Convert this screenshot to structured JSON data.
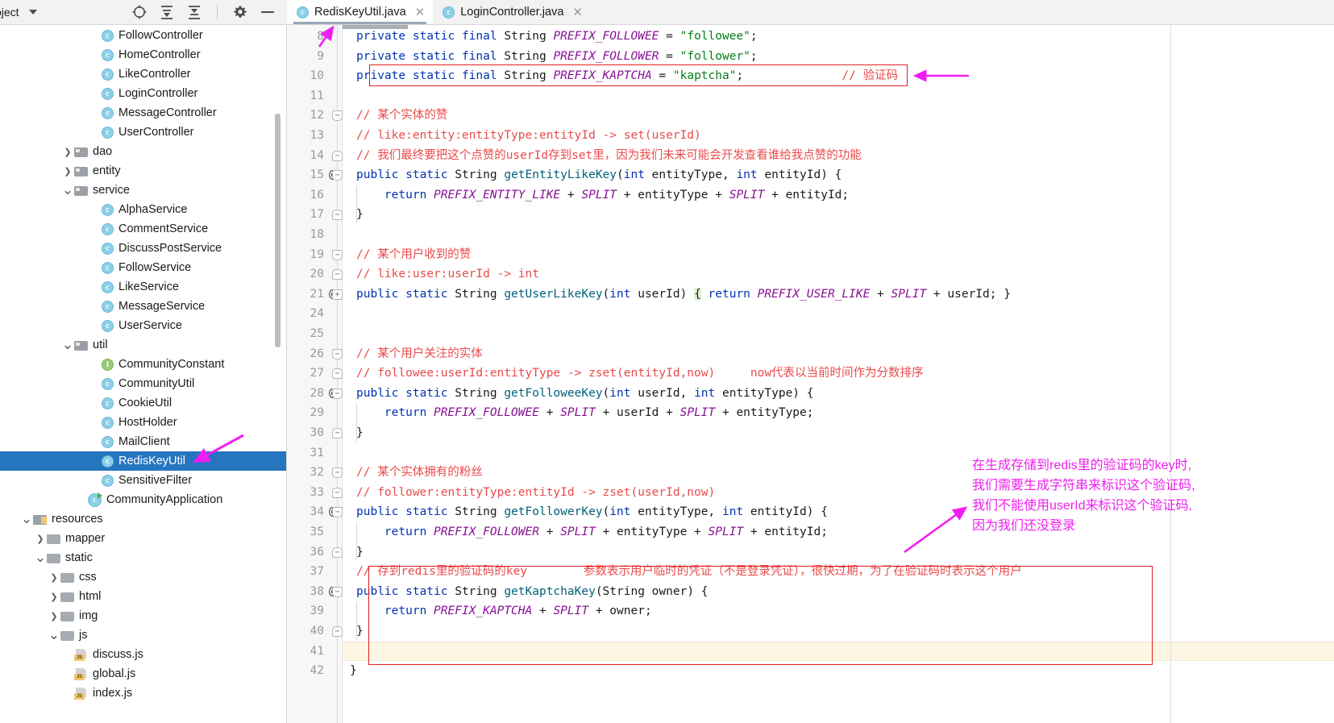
{
  "window": {
    "tool_window_title": "oject",
    "toolbar_icons": [
      "locate-icon",
      "expand-all-icon",
      "collapse-all-icon",
      "gear-icon",
      "minimize-icon"
    ]
  },
  "tabs": [
    {
      "label": "RedisKeyUtil.java",
      "icon": "java-class-icon",
      "active": true,
      "closable": true
    },
    {
      "label": "LoginController.java",
      "icon": "java-class-icon",
      "active": false,
      "closable": true
    }
  ],
  "tree": {
    "items": [
      {
        "label": "FollowController",
        "indent": 6,
        "icon": "class-icon",
        "arrow": ""
      },
      {
        "label": "HomeController",
        "indent": 6,
        "icon": "class-icon",
        "arrow": ""
      },
      {
        "label": "LikeController",
        "indent": 6,
        "icon": "class-icon",
        "arrow": ""
      },
      {
        "label": "LoginController",
        "indent": 6,
        "icon": "class-icon",
        "arrow": ""
      },
      {
        "label": "MessageController",
        "indent": 6,
        "icon": "class-icon",
        "arrow": ""
      },
      {
        "label": "UserController",
        "indent": 6,
        "icon": "class-icon",
        "arrow": ""
      },
      {
        "label": "dao",
        "indent": 4,
        "icon": "folder-icon",
        "arrow": "collapsed"
      },
      {
        "label": "entity",
        "indent": 4,
        "icon": "folder-icon",
        "arrow": "collapsed"
      },
      {
        "label": "service",
        "indent": 4,
        "icon": "folder-icon",
        "arrow": "expanded"
      },
      {
        "label": "AlphaService",
        "indent": 6,
        "icon": "class-icon",
        "arrow": ""
      },
      {
        "label": "CommentService",
        "indent": 6,
        "icon": "class-icon",
        "arrow": ""
      },
      {
        "label": "DiscussPostService",
        "indent": 6,
        "icon": "class-icon",
        "arrow": ""
      },
      {
        "label": "FollowService",
        "indent": 6,
        "icon": "class-icon",
        "arrow": ""
      },
      {
        "label": "LikeService",
        "indent": 6,
        "icon": "class-icon",
        "arrow": ""
      },
      {
        "label": "MessageService",
        "indent": 6,
        "icon": "class-icon",
        "arrow": ""
      },
      {
        "label": "UserService",
        "indent": 6,
        "icon": "class-icon",
        "arrow": ""
      },
      {
        "label": "util",
        "indent": 4,
        "icon": "folder-icon",
        "arrow": "expanded"
      },
      {
        "label": "CommunityConstant",
        "indent": 6,
        "icon": "interface-icon",
        "arrow": ""
      },
      {
        "label": "CommunityUtil",
        "indent": 6,
        "icon": "class-icon",
        "arrow": ""
      },
      {
        "label": "CookieUtil",
        "indent": 6,
        "icon": "class-icon",
        "arrow": ""
      },
      {
        "label": "HostHolder",
        "indent": 6,
        "icon": "class-icon",
        "arrow": ""
      },
      {
        "label": "MailClient",
        "indent": 6,
        "icon": "class-icon",
        "arrow": ""
      },
      {
        "label": "RedisKeyUtil",
        "indent": 6,
        "icon": "class-icon",
        "arrow": "",
        "selected": true
      },
      {
        "label": "SensitiveFilter",
        "indent": 6,
        "icon": "class-icon",
        "arrow": ""
      },
      {
        "label": "CommunityApplication",
        "indent": 5,
        "icon": "runnable-class-icon",
        "arrow": ""
      },
      {
        "label": "resources",
        "indent": 1,
        "icon": "resources-folder-icon",
        "arrow": "expanded"
      },
      {
        "label": "mapper",
        "indent": 2,
        "icon": "folder-plain-icon",
        "arrow": "collapsed"
      },
      {
        "label": "static",
        "indent": 2,
        "icon": "folder-plain-icon",
        "arrow": "expanded"
      },
      {
        "label": "css",
        "indent": 3,
        "icon": "folder-plain-icon",
        "arrow": "collapsed"
      },
      {
        "label": "html",
        "indent": 3,
        "icon": "folder-plain-icon",
        "arrow": "collapsed"
      },
      {
        "label": "img",
        "indent": 3,
        "icon": "folder-plain-icon",
        "arrow": "collapsed"
      },
      {
        "label": "js",
        "indent": 3,
        "icon": "folder-plain-icon",
        "arrow": "expanded"
      },
      {
        "label": "discuss.js",
        "indent": 4,
        "icon": "js-file-icon",
        "arrow": ""
      },
      {
        "label": "global.js",
        "indent": 4,
        "icon": "js-file-icon",
        "arrow": ""
      },
      {
        "label": "index.js",
        "indent": 4,
        "icon": "js-file-icon",
        "arrow": ""
      }
    ]
  },
  "editor": {
    "file": "RedisKeyUtil.java",
    "lines": [
      {
        "num": "8",
        "at": false,
        "fold": "",
        "indent": 1,
        "tokens": [
          {
            "t": "private ",
            "c": "kw"
          },
          {
            "t": "static ",
            "c": "kw"
          },
          {
            "t": "final ",
            "c": "kw"
          },
          {
            "t": "String ",
            "c": "type"
          },
          {
            "t": "PREFIX_FOLLOWEE",
            "c": "field"
          },
          {
            "t": " = ",
            "c": "type"
          },
          {
            "t": "\"followee\"",
            "c": "str"
          },
          {
            "t": ";",
            "c": "type"
          }
        ]
      },
      {
        "num": "9",
        "at": false,
        "fold": "",
        "indent": 1,
        "tokens": [
          {
            "t": "private ",
            "c": "kw"
          },
          {
            "t": "static ",
            "c": "kw"
          },
          {
            "t": "final ",
            "c": "kw"
          },
          {
            "t": "String ",
            "c": "type"
          },
          {
            "t": "PREFIX_FOLLOWER",
            "c": "field"
          },
          {
            "t": " = ",
            "c": "type"
          },
          {
            "t": "\"follower\"",
            "c": "str"
          },
          {
            "t": ";",
            "c": "type"
          }
        ]
      },
      {
        "num": "10",
        "at": false,
        "fold": "",
        "indent": 1,
        "tokens": [
          {
            "t": "private ",
            "c": "kw"
          },
          {
            "t": "static ",
            "c": "kw"
          },
          {
            "t": "final ",
            "c": "kw"
          },
          {
            "t": "String ",
            "c": "type"
          },
          {
            "t": "PREFIX_KAPTCHA",
            "c": "field"
          },
          {
            "t": " = ",
            "c": "type"
          },
          {
            "t": "\"kaptcha\"",
            "c": "str"
          },
          {
            "t": ";",
            "c": "type"
          },
          {
            "t": "              ",
            "c": "type"
          },
          {
            "t": "// 验证码",
            "c": "cmt"
          }
        ]
      },
      {
        "num": "11",
        "at": false,
        "fold": "",
        "indent": 0,
        "tokens": []
      },
      {
        "num": "12",
        "at": false,
        "fold": "start",
        "indent": 1,
        "tokens": [
          {
            "t": "// 某个实体的赞",
            "c": "cmt"
          }
        ]
      },
      {
        "num": "13",
        "at": false,
        "fold": "",
        "indent": 1,
        "tokens": [
          {
            "t": "// like:entity:entityType:entityId -> set(userId)",
            "c": "cmt"
          }
        ]
      },
      {
        "num": "14",
        "at": false,
        "fold": "end",
        "indent": 1,
        "tokens": [
          {
            "t": "// 我们最终要把这个点赞的userId存到set里，因为我们未来可能会开发查看谁给我点赞的功能",
            "c": "cmt"
          }
        ]
      },
      {
        "num": "15",
        "at": true,
        "fold": "start",
        "indent": 1,
        "tokens": [
          {
            "t": "public ",
            "c": "kw"
          },
          {
            "t": "static ",
            "c": "kw"
          },
          {
            "t": "String ",
            "c": "type"
          },
          {
            "t": "getEntityLikeKey",
            "c": "mth"
          },
          {
            "t": "(",
            "c": "type"
          },
          {
            "t": "int",
            "c": "kw"
          },
          {
            "t": " entityType, ",
            "c": "type"
          },
          {
            "t": "int",
            "c": "kw"
          },
          {
            "t": " entityId) {",
            "c": "type"
          }
        ]
      },
      {
        "num": "16",
        "at": false,
        "fold": "",
        "indent": 2,
        "tokens": [
          {
            "t": "    return ",
            "c": "kw"
          },
          {
            "t": "PREFIX_ENTITY_LIKE",
            "c": "field"
          },
          {
            "t": " + ",
            "c": "type"
          },
          {
            "t": "SPLIT",
            "c": "field"
          },
          {
            "t": " + entityType + ",
            "c": "type"
          },
          {
            "t": "SPLIT",
            "c": "field"
          },
          {
            "t": " + entityId;",
            "c": "type"
          }
        ]
      },
      {
        "num": "17",
        "at": false,
        "fold": "end",
        "indent": 1,
        "tokens": [
          {
            "t": "}",
            "c": "type"
          }
        ]
      },
      {
        "num": "18",
        "at": false,
        "fold": "",
        "indent": 0,
        "tokens": []
      },
      {
        "num": "19",
        "at": false,
        "fold": "start",
        "indent": 1,
        "tokens": [
          {
            "t": "// 某个用户收到的赞",
            "c": "cmt"
          }
        ]
      },
      {
        "num": "20",
        "at": false,
        "fold": "end",
        "indent": 1,
        "tokens": [
          {
            "t": "// like:user:userId -> int",
            "c": "cmt"
          }
        ]
      },
      {
        "num": "21",
        "at": true,
        "fold": "plus",
        "indent": 1,
        "tokens": [
          {
            "t": "public ",
            "c": "kw"
          },
          {
            "t": "static ",
            "c": "kw"
          },
          {
            "t": "String ",
            "c": "type"
          },
          {
            "t": "getUserLikeKey",
            "c": "mth"
          },
          {
            "t": "(",
            "c": "type"
          },
          {
            "t": "int",
            "c": "kw"
          },
          {
            "t": " userId) ",
            "c": "type"
          },
          {
            "t": "{",
            "c": "brace-hl"
          },
          {
            "t": " ",
            "c": "type"
          },
          {
            "t": "return ",
            "c": "kw"
          },
          {
            "t": "PREFIX_USER_LIKE",
            "c": "field"
          },
          {
            "t": " + ",
            "c": "type"
          },
          {
            "t": "SPLIT",
            "c": "field"
          },
          {
            "t": " + userId; }",
            "c": "type"
          }
        ]
      },
      {
        "num": "24",
        "at": false,
        "fold": "",
        "indent": 0,
        "tokens": []
      },
      {
        "num": "25",
        "at": false,
        "fold": "",
        "indent": 0,
        "tokens": []
      },
      {
        "num": "26",
        "at": false,
        "fold": "start",
        "indent": 1,
        "tokens": [
          {
            "t": "// 某个用户关注的实体",
            "c": "cmt"
          }
        ]
      },
      {
        "num": "27",
        "at": false,
        "fold": "end",
        "indent": 1,
        "tokens": [
          {
            "t": "// followee:userId:entityType -> zset(entityId,now)     now代表以当前时间作为分数排序",
            "c": "cmt"
          }
        ]
      },
      {
        "num": "28",
        "at": true,
        "fold": "start",
        "indent": 1,
        "tokens": [
          {
            "t": "public ",
            "c": "kw"
          },
          {
            "t": "static ",
            "c": "kw"
          },
          {
            "t": "String ",
            "c": "type"
          },
          {
            "t": "getFolloweeKey",
            "c": "mth"
          },
          {
            "t": "(",
            "c": "type"
          },
          {
            "t": "int",
            "c": "kw"
          },
          {
            "t": " userId, ",
            "c": "type"
          },
          {
            "t": "int",
            "c": "kw"
          },
          {
            "t": " entityType) {",
            "c": "type"
          }
        ]
      },
      {
        "num": "29",
        "at": false,
        "fold": "",
        "indent": 2,
        "tokens": [
          {
            "t": "    return ",
            "c": "kw"
          },
          {
            "t": "PREFIX_FOLLOWEE",
            "c": "field"
          },
          {
            "t": " + ",
            "c": "type"
          },
          {
            "t": "SPLIT",
            "c": "field"
          },
          {
            "t": " + userId + ",
            "c": "type"
          },
          {
            "t": "SPLIT",
            "c": "field"
          },
          {
            "t": " + entityType;",
            "c": "type"
          }
        ]
      },
      {
        "num": "30",
        "at": false,
        "fold": "end",
        "indent": 1,
        "tokens": [
          {
            "t": "}",
            "c": "type"
          }
        ]
      },
      {
        "num": "31",
        "at": false,
        "fold": "",
        "indent": 0,
        "tokens": []
      },
      {
        "num": "32",
        "at": false,
        "fold": "start",
        "indent": 1,
        "tokens": [
          {
            "t": "// 某个实体拥有的粉丝",
            "c": "cmt"
          }
        ]
      },
      {
        "num": "33",
        "at": false,
        "fold": "end",
        "indent": 1,
        "tokens": [
          {
            "t": "// follower:entityType:entityId -> zset(userId,now)",
            "c": "cmt"
          }
        ]
      },
      {
        "num": "34",
        "at": true,
        "fold": "start",
        "indent": 1,
        "tokens": [
          {
            "t": "public ",
            "c": "kw"
          },
          {
            "t": "static ",
            "c": "kw"
          },
          {
            "t": "String ",
            "c": "type"
          },
          {
            "t": "getFollowerKey",
            "c": "mth"
          },
          {
            "t": "(",
            "c": "type"
          },
          {
            "t": "int",
            "c": "kw"
          },
          {
            "t": " entityType, ",
            "c": "type"
          },
          {
            "t": "int",
            "c": "kw"
          },
          {
            "t": " entityId) {",
            "c": "type"
          }
        ]
      },
      {
        "num": "35",
        "at": false,
        "fold": "",
        "indent": 2,
        "tokens": [
          {
            "t": "    return ",
            "c": "kw"
          },
          {
            "t": "PREFIX_FOLLOWER",
            "c": "field"
          },
          {
            "t": " + ",
            "c": "type"
          },
          {
            "t": "SPLIT",
            "c": "field"
          },
          {
            "t": " + entityType + ",
            "c": "type"
          },
          {
            "t": "SPLIT",
            "c": "field"
          },
          {
            "t": " + entityId;",
            "c": "type"
          }
        ]
      },
      {
        "num": "36",
        "at": false,
        "fold": "end",
        "indent": 1,
        "tokens": [
          {
            "t": "}",
            "c": "type"
          }
        ]
      },
      {
        "num": "37",
        "at": false,
        "fold": "",
        "indent": 1,
        "tokens": [
          {
            "t": "// 存到redis里的验证码的key        参数表示用户临时的凭证（不是登录凭证），很快过期，为了在验证码时表示这个用户",
            "c": "cmt"
          }
        ]
      },
      {
        "num": "38",
        "at": true,
        "fold": "start",
        "indent": 1,
        "tokens": [
          {
            "t": "public ",
            "c": "kw"
          },
          {
            "t": "static ",
            "c": "kw"
          },
          {
            "t": "String ",
            "c": "type"
          },
          {
            "t": "getKaptchaKey",
            "c": "mth"
          },
          {
            "t": "(String owner) {",
            "c": "type"
          }
        ]
      },
      {
        "num": "39",
        "at": false,
        "fold": "",
        "indent": 2,
        "tokens": [
          {
            "t": "    return ",
            "c": "kw"
          },
          {
            "t": "PREFIX_KAPTCHA",
            "c": "field"
          },
          {
            "t": " + ",
            "c": "type"
          },
          {
            "t": "SPLIT",
            "c": "field"
          },
          {
            "t": " + owner;",
            "c": "type"
          }
        ]
      },
      {
        "num": "40",
        "at": false,
        "fold": "end",
        "indent": 1,
        "tokens": [
          {
            "t": "}",
            "c": "type"
          }
        ]
      },
      {
        "num": "41",
        "at": false,
        "fold": "",
        "indent": 0,
        "highlight": true,
        "tokens": []
      },
      {
        "num": "42",
        "at": false,
        "fold": "",
        "indent": 0,
        "tokens": [
          {
            "t": "}",
            "c": "type"
          }
        ],
        "noindent": true
      }
    ]
  },
  "annotations": {
    "accent_color": "#f01ef0",
    "box_color": "#e02020",
    "note": {
      "lines": [
        "在生成存储到redis里的验证码的key时,",
        "我们需要生成字符串来标识这个验证码,",
        "我们不能使用userId来标识这个验证码,",
        "因为我们还没登录"
      ]
    },
    "arrows": [
      "arrow-to-line-8",
      "arrow-to-kaptcha-constant",
      "arrow-to-redis-key-util-file",
      "arrow-to-kaptcha-method-box"
    ],
    "boxes": [
      "box-around-prefix-kaptcha-constant",
      "box-around-get-kaptcha-key-method"
    ]
  }
}
